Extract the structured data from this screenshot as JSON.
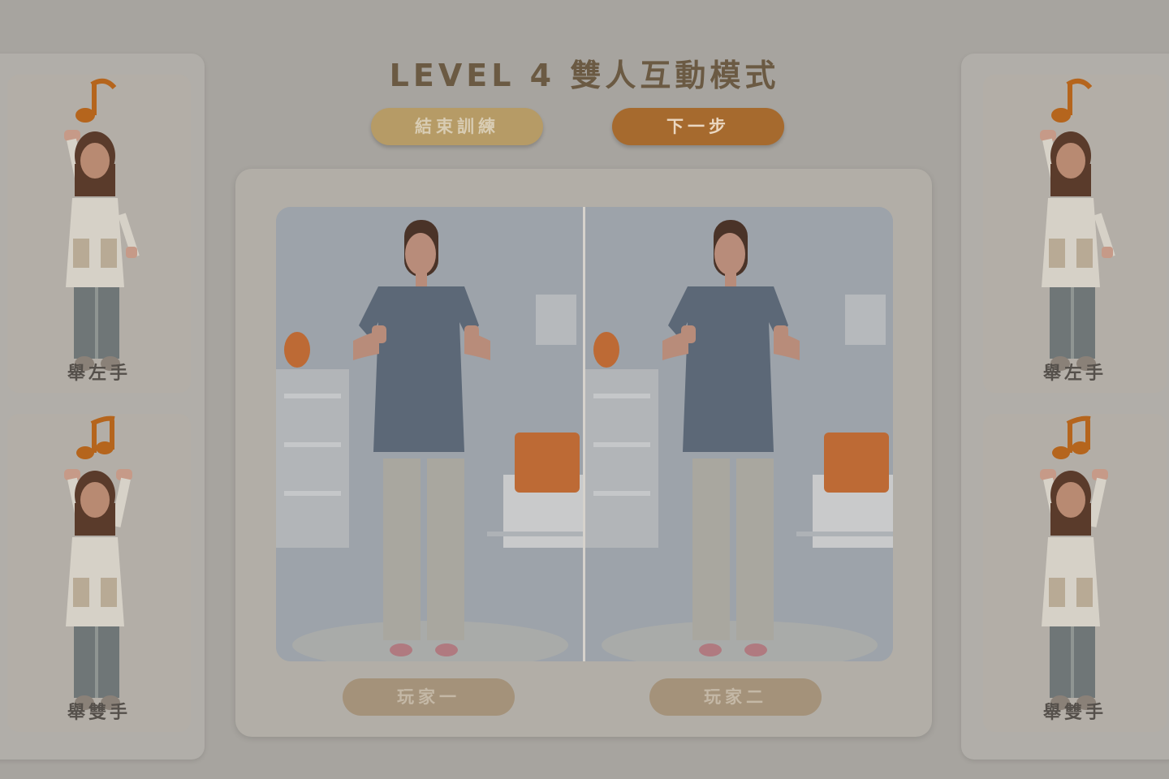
{
  "header": {
    "title": "LEVEL 4 雙人互動模式"
  },
  "actions": {
    "end_label": "結束訓練",
    "next_label": "下一步"
  },
  "left_panel": {
    "cards": [
      {
        "label": "舉左手",
        "icon": "raise-left-hand-icon"
      },
      {
        "label": "舉雙手",
        "icon": "raise-both-hands-icon"
      }
    ]
  },
  "right_panel": {
    "cards": [
      {
        "label": "舉左手",
        "icon": "raise-left-hand-icon"
      },
      {
        "label": "舉雙手",
        "icon": "raise-both-hands-icon"
      }
    ]
  },
  "stage": {
    "players": [
      {
        "label": "玩家一"
      },
      {
        "label": "玩家二"
      }
    ]
  },
  "colors": {
    "background": "#a7a49f",
    "accent_orange": "#a66a2e",
    "accent_gold": "#b69b66",
    "title_brown": "#6b5a43"
  }
}
